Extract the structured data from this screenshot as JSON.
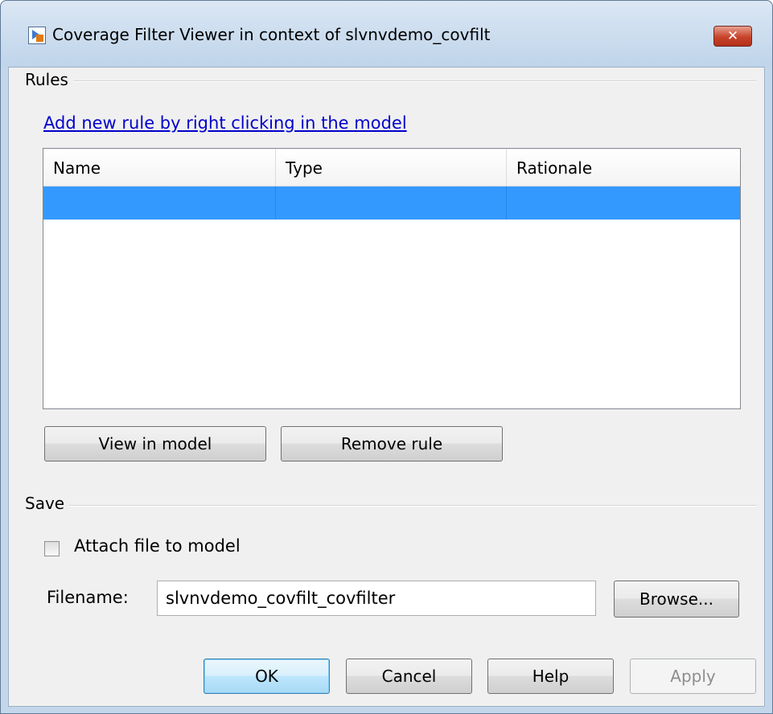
{
  "window": {
    "title": "Coverage Filter Viewer in context of slvnvdemo_covfilt",
    "close_glyph": "✕"
  },
  "rules": {
    "section_label": "Rules",
    "add_rule_link": "Add new rule by right clicking in the model",
    "table": {
      "columns": [
        "Name",
        "Type",
        "Rationale"
      ],
      "rows": [
        {
          "name": "",
          "type": "",
          "rationale": "",
          "selected": true
        }
      ]
    },
    "view_in_model_label": "View in model",
    "remove_rule_label": "Remove rule"
  },
  "save": {
    "section_label": "Save",
    "attach_label": "Attach file to model",
    "attach_checked": false,
    "filename_label": "Filename:",
    "filename_value": "slvnvdemo_covfilt_covfilter",
    "browse_label": "Browse..."
  },
  "footer": {
    "ok_label": "OK",
    "cancel_label": "Cancel",
    "help_label": "Help",
    "apply_label": "Apply"
  },
  "colors": {
    "selection": "#3399ff",
    "link": "#0000cc",
    "close_button": "#c7432a"
  }
}
